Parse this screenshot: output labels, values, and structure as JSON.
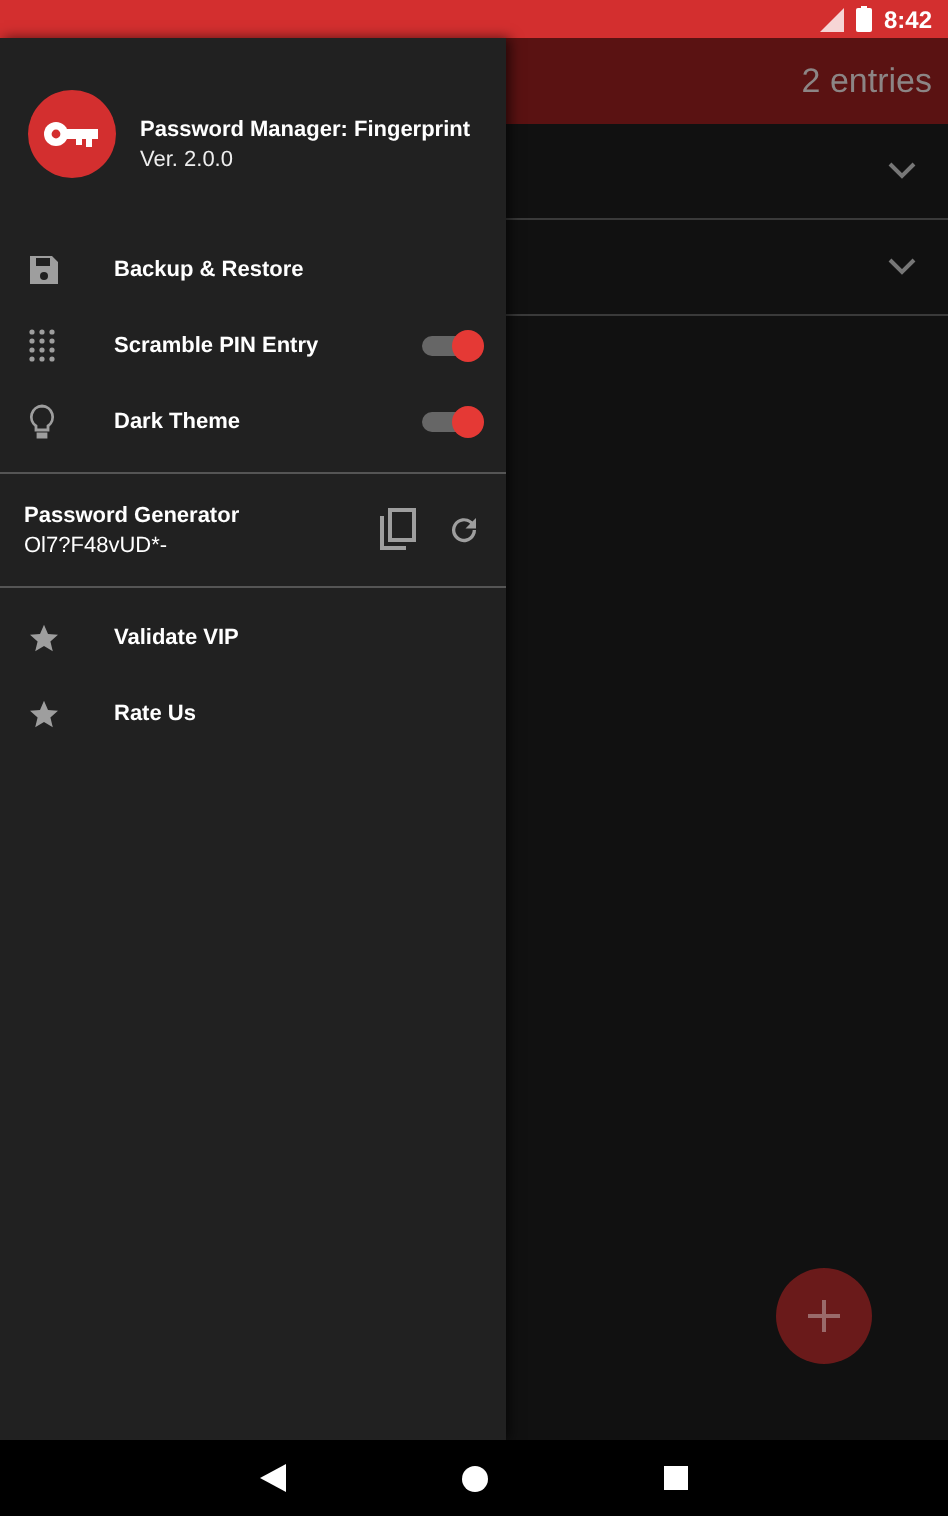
{
  "status_bar": {
    "time": "8:42"
  },
  "drawer": {
    "title": "Password Manager: Fingerprint",
    "version": "Ver. 2.0.0",
    "settings": [
      {
        "kind": "action",
        "label": "Backup & Restore"
      },
      {
        "kind": "toggle",
        "label": "Scramble PIN Entry",
        "on": true
      },
      {
        "kind": "toggle",
        "label": "Dark Theme",
        "on": true
      }
    ],
    "generator": {
      "title": "Password Generator",
      "value": "Ol7?F48vUD*-"
    },
    "links": [
      {
        "label": "Validate VIP"
      },
      {
        "label": "Rate Us"
      }
    ]
  },
  "main": {
    "count": "2 entries",
    "entries": [
      {
        "expanded": false
      },
      {
        "expanded": false
      }
    ]
  }
}
